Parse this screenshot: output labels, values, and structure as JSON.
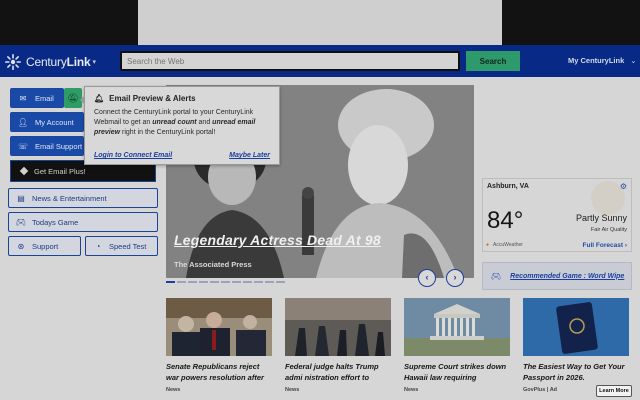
{
  "header": {
    "brand": "CenturyLink",
    "brand_plain": "Century",
    "brand_bold": "Link",
    "search_placeholder": "Search the Web",
    "search_button": "Search",
    "account_menu": "My CenturyLink"
  },
  "nav": {
    "email": "Email",
    "my_account": "My Account",
    "email_support": "Email Support",
    "get_email_plus": "Get Email Plus!",
    "news_entertainment": "News & Entertainment",
    "todays_game": "Todays Game",
    "support": "Support",
    "speed_test": "Speed Test"
  },
  "popup": {
    "title": "Email Preview & Alerts",
    "body_1": "Connect the CenturyLink portal to your CenturyLink Webmail to get an ",
    "body_em1": "unread count",
    "body_2": " and ",
    "body_em2": "unread email preview",
    "body_3": " right in the CenturyLink portal!",
    "login_link": "Login to Connect Email",
    "later_link": "Maybe Later"
  },
  "hero": {
    "headline": "Legendary Actress Dead At 98",
    "source": "The Associated Press",
    "slide_count": 11,
    "active_slide": 1
  },
  "weather": {
    "location": "Ashburn, VA",
    "temperature": "84°",
    "condition": "Partly Sunny",
    "air_quality": "Fair Air Quality",
    "provider": "AccuWeather",
    "forecast_link": "Full Forecast"
  },
  "recommended_game": {
    "label": "Recommended Game : Word Wipe"
  },
  "news": [
    {
      "title": "Senate Republicans reject war powers resolution after",
      "source": "News"
    },
    {
      "title": "Federal judge halts Trump admi nistration effort to",
      "source": "News"
    },
    {
      "title": "Supreme Court strikes down Hawaii law requiring",
      "source": "News"
    },
    {
      "title": "The Easiest Way to Get Your Passport in 2026.",
      "source": "GovPlus | Ad",
      "cta": "Learn More"
    }
  ],
  "colors": {
    "header_bg": "#082a86",
    "search_button": "#2e9a6c",
    "link_blue": "#1b3f9e"
  }
}
